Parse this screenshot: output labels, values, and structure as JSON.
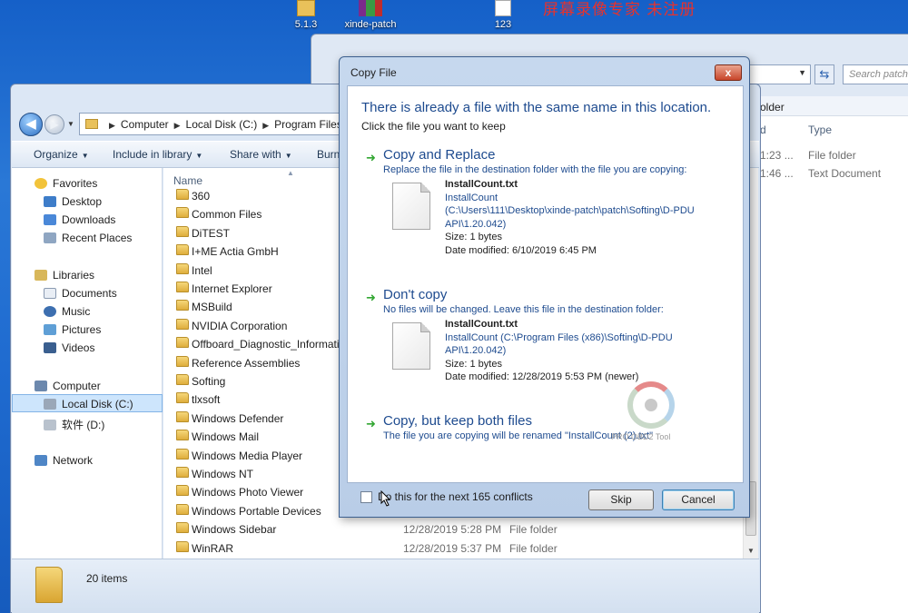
{
  "desktop": {
    "icons": [
      {
        "label": "5.1.3"
      },
      {
        "label": "xinde-patch"
      },
      {
        "label": "123"
      }
    ],
    "watermark": "屏幕录像专家 未注册"
  },
  "back_window": {
    "search_placeholder": "Search patch",
    "crumb": "older",
    "col_size_fragment": "d",
    "col_type": "Type",
    "rows": [
      {
        "time_fragment": "1:23 ...",
        "type": "File folder"
      },
      {
        "time_fragment": "1:46 ...",
        "type": "Text Document"
      }
    ]
  },
  "explorer": {
    "address": {
      "parts": [
        "Computer",
        "Local Disk (C:)",
        "Program Files ("
      ]
    },
    "toolbar": {
      "organize": "Organize",
      "include_in_library": "Include in library",
      "share_with": "Share with",
      "burn": "Burn"
    },
    "nav": {
      "favorites": "Favorites",
      "desktop": "Desktop",
      "downloads": "Downloads",
      "recent_places": "Recent Places",
      "libraries": "Libraries",
      "documents": "Documents",
      "music": "Music",
      "pictures": "Pictures",
      "videos": "Videos",
      "computer": "Computer",
      "local_disk": "Local Disk (C:)",
      "drive_d": "软件 (D:)",
      "network": "Network"
    },
    "column_name": "Name",
    "files": [
      {
        "name": "360",
        "date": "",
        "type": ""
      },
      {
        "name": "Common Files",
        "date": "",
        "type": ""
      },
      {
        "name": "DiTEST",
        "date": "",
        "type": ""
      },
      {
        "name": "I+ME Actia GmbH",
        "date": "",
        "type": ""
      },
      {
        "name": "Intel",
        "date": "",
        "type": ""
      },
      {
        "name": "Internet Explorer",
        "date": "",
        "type": ""
      },
      {
        "name": "MSBuild",
        "date": "",
        "type": ""
      },
      {
        "name": "NVIDIA Corporation",
        "date": "",
        "type": ""
      },
      {
        "name": "Offboard_Diagnostic_Informatio",
        "date": "",
        "type": ""
      },
      {
        "name": "Reference Assemblies",
        "date": "",
        "type": ""
      },
      {
        "name": "Softing",
        "date": "",
        "type": ""
      },
      {
        "name": "tlxsoft",
        "date": "",
        "type": ""
      },
      {
        "name": "Windows Defender",
        "date": "",
        "type": ""
      },
      {
        "name": "Windows Mail",
        "date": "",
        "type": ""
      },
      {
        "name": "Windows Media Player",
        "date": "",
        "type": ""
      },
      {
        "name": "Windows NT",
        "date": "",
        "type": ""
      },
      {
        "name": "Windows Photo Viewer",
        "date": "",
        "type": ""
      },
      {
        "name": "Windows Portable Devices",
        "date": "",
        "type": ""
      },
      {
        "name": "Windows Sidebar",
        "date": "12/28/2019 5:28 PM",
        "type": "File folder"
      },
      {
        "name": "WinRAR",
        "date": "12/28/2019 5:37 PM",
        "type": "File folder"
      }
    ],
    "status": "20 items"
  },
  "dialog": {
    "title": "Copy File",
    "close_label": "x",
    "headline": "There is already a file with the same name in this location.",
    "subline": "Click the file you want to keep",
    "replace": {
      "title": "Copy and Replace",
      "desc": "Replace the file in the destination folder with the file you are copying:",
      "file_name": "InstallCount.txt",
      "path_line1": "InstallCount",
      "path_line2": "(C:\\Users\\111\\Desktop\\xinde-patch\\patch\\Softing\\D-PDU",
      "path_line3": "API\\1.20.042)",
      "size": "Size: 1 bytes",
      "modified": "Date modified: 6/10/2019 6:45 PM"
    },
    "dont_copy": {
      "title": "Don't copy",
      "desc": "No files will be changed. Leave this file in the destination folder:",
      "file_name": "InstallCount.txt",
      "path_line1": "InstallCount (C:\\Program Files (x86)\\Softing\\D-PDU",
      "path_line2": "API\\1.20.042)",
      "size": "Size: 1 bytes",
      "modified": "Date modified: 12/28/2019 5:53 PM (newer)"
    },
    "keep_both": {
      "title": "Copy, but keep both files",
      "desc": "The file you are copying will be renamed \"InstallCount (2).txt\""
    },
    "logo_text": "PRO OBD2 Tool",
    "checkbox_label": "Do this for the next 165 conflicts",
    "skip_label": "Skip",
    "cancel_label": "Cancel"
  }
}
